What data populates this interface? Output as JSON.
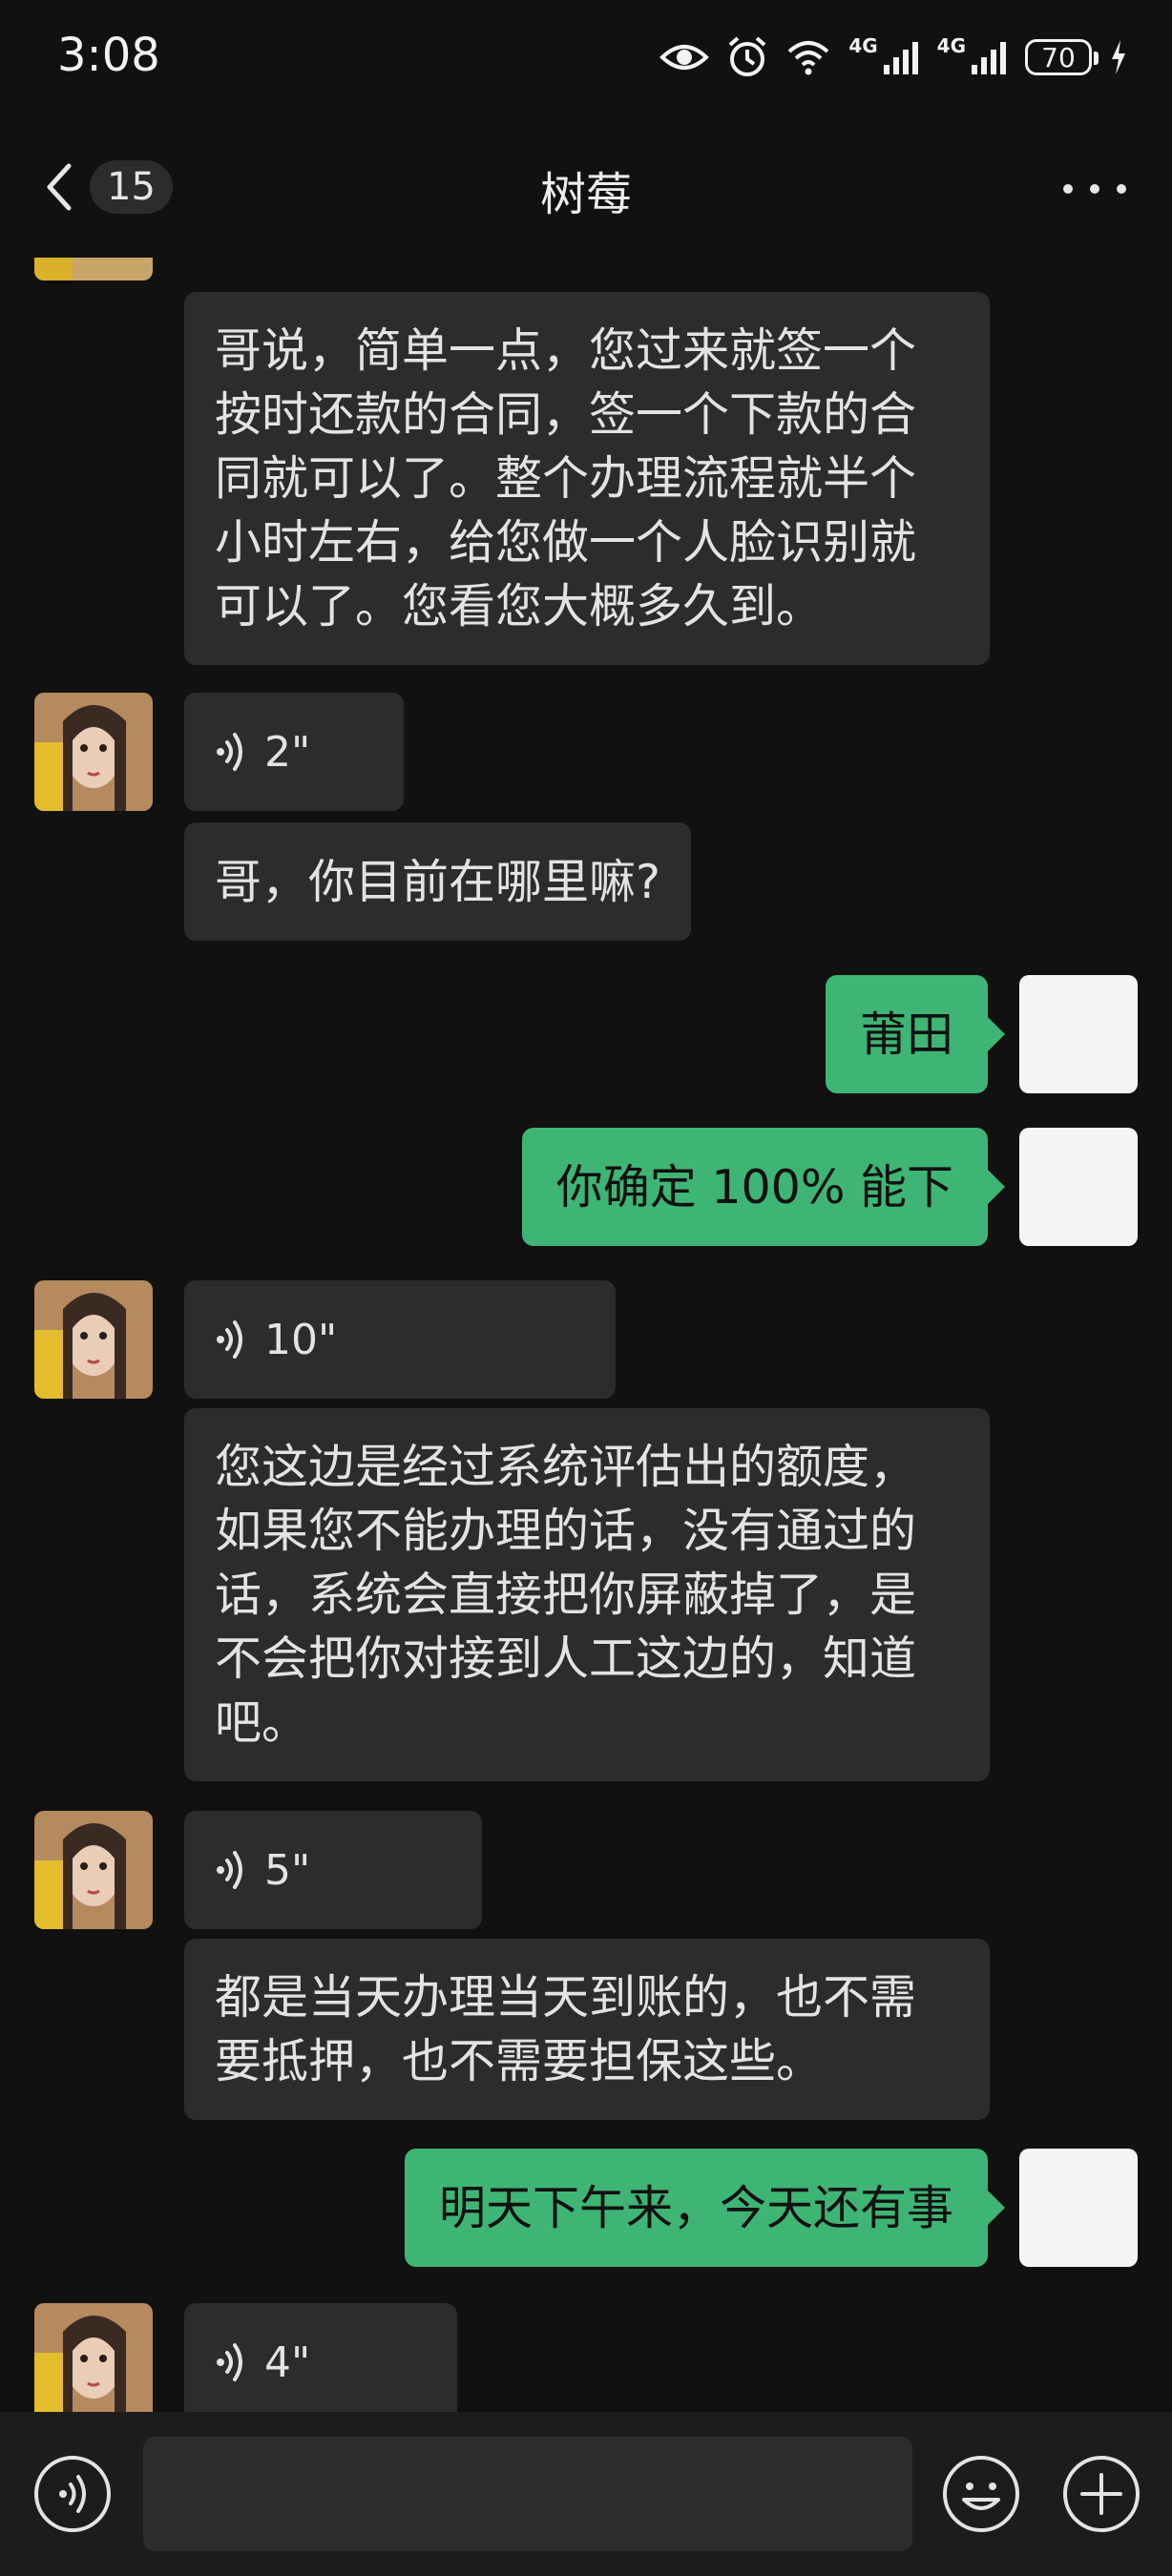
{
  "status_bar": {
    "time": "3:08",
    "network_label_1": "4G",
    "network_label_2": "4G",
    "battery": "70",
    "icons": [
      "eye-icon",
      "alarm-icon",
      "wifi-icon",
      "signal-icon",
      "signal-icon",
      "battery-icon",
      "charging-icon"
    ]
  },
  "nav": {
    "back_icon": "chevron-left-icon",
    "unread_count": "15",
    "title": "树莓",
    "more_icon": "more-dots-icon"
  },
  "messages": [
    {
      "side": "in",
      "type": "text",
      "text": "哥说，简单一点，您过来就签一个\n按时还款的合同，签一个下款的合\n同就可以了。整个办理流程就半个\n小时左右，给您做一个人脸识别就\n可以了。您看您大概多久到。"
    },
    {
      "side": "in",
      "type": "voice",
      "duration": "2\""
    },
    {
      "side": "in",
      "type": "text",
      "text": "哥，你目前在哪里嘛?"
    },
    {
      "side": "out",
      "type": "text",
      "text": "莆田"
    },
    {
      "side": "out",
      "type": "text",
      "text": "你确定 100% 能下"
    },
    {
      "side": "in",
      "type": "voice",
      "duration": "10\""
    },
    {
      "side": "in",
      "type": "text",
      "text": "您这边是经过系统评估出的额度，\n如果您不能办理的话，没有通过的\n话，系统会直接把你屏蔽掉了，是\n不会把你对接到人工这边的，知道\n吧。"
    },
    {
      "side": "in",
      "type": "voice",
      "duration": "5\""
    },
    {
      "side": "in",
      "type": "text",
      "text": "都是当天办理当天到账的，也不需\n要抵押，也不需要担保这些。"
    },
    {
      "side": "out",
      "type": "text",
      "text": "明天下午来，今天还有事"
    },
    {
      "side": "in",
      "type": "voice",
      "duration": "4\""
    }
  ],
  "colors": {
    "background": "#111111",
    "incoming_bubble": "#2c2c2c",
    "outgoing_bubble": "#3eb575",
    "input_bar": "#1c1c1c"
  },
  "input_bar": {
    "voice_icon": "voice-input-icon",
    "emoji_icon": "emoji-icon",
    "plus_icon": "plus-icon",
    "input_value": ""
  }
}
